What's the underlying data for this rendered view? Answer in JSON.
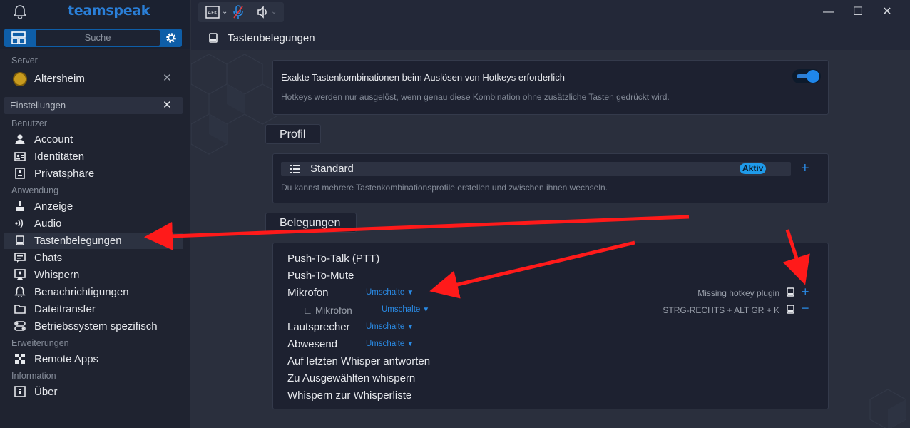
{
  "app": {
    "logo": "teamspeak",
    "search_placeholder": "Suche"
  },
  "server": {
    "label": "Server",
    "name": "Altersheim"
  },
  "settings_search": "Einstellungen",
  "nav": {
    "groups": [
      {
        "label": "Benutzer"
      },
      {
        "label": "Anwendung"
      },
      {
        "label": "Erweiterungen"
      },
      {
        "label": "Information"
      }
    ],
    "items": [
      {
        "label": "Account",
        "icon": "user-icon"
      },
      {
        "label": "Identitäten",
        "icon": "id-card-icon"
      },
      {
        "label": "Privatsphäre",
        "icon": "privacy-icon"
      },
      {
        "label": "Anzeige",
        "icon": "brush-icon"
      },
      {
        "label": "Audio",
        "icon": "audio-icon"
      },
      {
        "label": "Tastenbelegungen",
        "icon": "keyboard-icon",
        "active": true
      },
      {
        "label": "Chats",
        "icon": "chat-icon"
      },
      {
        "label": "Whispern",
        "icon": "whisper-icon"
      },
      {
        "label": "Benachrichtigungen",
        "icon": "bell-icon"
      },
      {
        "label": "Dateitransfer",
        "icon": "folder-icon"
      },
      {
        "label": "Betriebssystem spezifisch",
        "icon": "os-icon"
      },
      {
        "label": "Remote Apps",
        "icon": "remote-icon"
      },
      {
        "label": "Über",
        "icon": "info-icon"
      }
    ]
  },
  "page": {
    "title": "Tastenbelegungen"
  },
  "exact_combo": {
    "heading": "Exakte Tastenkombinationen beim Auslösen von Hotkeys erforderlich",
    "description": "Hotkeys werden nur ausgelöst, wenn genau diese Kombination ohne zusätzliche Tasten gedrückt wird.",
    "enabled": true
  },
  "profile": {
    "section_label": "Profil",
    "name": "Standard",
    "badge": "Aktiv",
    "add": "+",
    "description": "Du kannst mehrere Tastenkombinationsprofile erstellen und zwischen ihnen wechseln."
  },
  "bindings": {
    "section_label": "Belegungen",
    "rows": [
      {
        "label": "Push-To-Talk (PTT)"
      },
      {
        "label": "Push-To-Mute"
      },
      {
        "label": "Mikrofon",
        "mode": "Umschalte",
        "hotkey": "Missing hotkey plugin",
        "action": "+"
      },
      {
        "label": "∟ Mikrofon",
        "mode": "Umschalte",
        "hotkey": "STRG-RECHTS + ALT GR + K",
        "action": "−"
      },
      {
        "label": "Lautsprecher",
        "mode": "Umschalte"
      },
      {
        "label": "Abwesend",
        "mode": "Umschalte"
      },
      {
        "label": "Auf letzten Whisper antworten"
      },
      {
        "label": "Zu Ausgewählten whispern"
      },
      {
        "label": "Whispern zur Whisperliste"
      }
    ]
  },
  "colors": {
    "accent": "#2a8ae4",
    "annotation_arrow": "#ff1a1a"
  }
}
